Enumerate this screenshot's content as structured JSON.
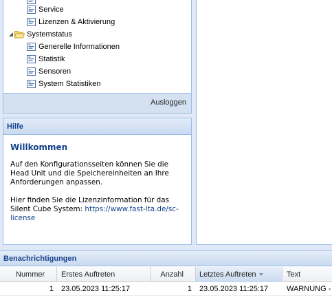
{
  "nav": {
    "tree": [
      {
        "label": "Service",
        "kind": "doc"
      },
      {
        "label": "Lizenzen & Aktivierung",
        "kind": "doc"
      },
      {
        "label": "Systemstatus",
        "kind": "folder"
      },
      {
        "label": "Generelle Informationen",
        "kind": "doc"
      },
      {
        "label": "Statistik",
        "kind": "doc"
      },
      {
        "label": "Sensoren",
        "kind": "doc"
      },
      {
        "label": "System Statistiken",
        "kind": "doc"
      }
    ],
    "logout_label": "Ausloggen"
  },
  "help": {
    "header": "Hilfe",
    "title": "Willkommen",
    "paragraph1": "Auf den Konfigurationsseiten können Sie die Head Unit und die Speichereinheiten an Ihre Anforderungen anpassen.",
    "paragraph2_prefix": "Hier finden Sie die Lizenzinformation für das Silent Cube System: ",
    "link_text": "https://www.fast-lta.de/sc-license"
  },
  "notifications": {
    "header": "Benachrichtigungen",
    "columns": [
      "Nummer",
      "Erstes Auftreten",
      "Anzahl",
      "Letztes Auftreten",
      "Text"
    ],
    "sorted_column": "Letztes Auftreten",
    "rows": [
      {
        "nummer": "1",
        "erstes": "23.05.2023 11:25:17",
        "anzahl": "1",
        "letztes": "23.05.2023 11:25:17",
        "text": "WARNUNG - "
      }
    ]
  },
  "colors": {
    "panel_border": "#99bbe8",
    "header_text": "#15428b",
    "background": "#dfe8f6"
  }
}
